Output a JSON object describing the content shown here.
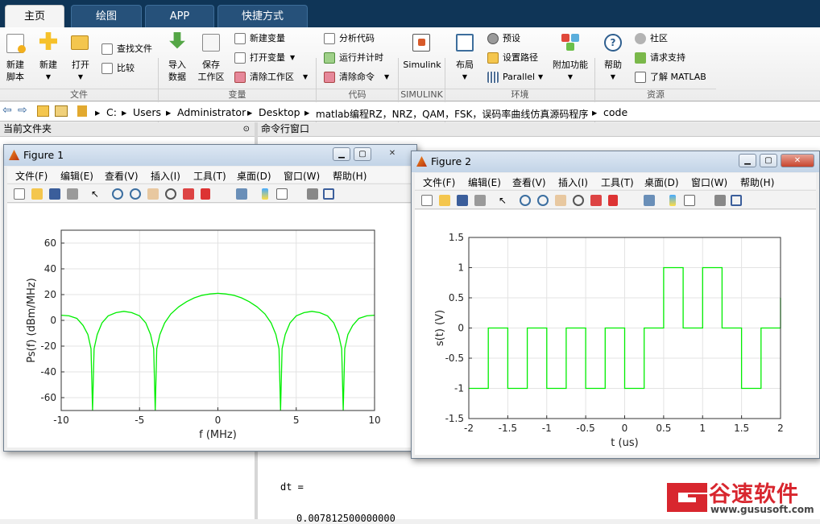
{
  "tabs": {
    "home": "主页",
    "plots": "绘图",
    "apps": "APP",
    "shortcuts": "快捷方式"
  },
  "ribbon": {
    "new_script": [
      "新建",
      "脚本"
    ],
    "new": "新建",
    "open": "打开",
    "find_files": "查找文件",
    "compare": "比较",
    "import": [
      "导入",
      "数据"
    ],
    "save_ws": [
      "保存",
      "工作区"
    ],
    "new_var": "新建变量",
    "open_var": "打开变量",
    "clear_ws": "清除工作区",
    "analyze": "分析代码",
    "run_time": "运行并计时",
    "clear_cmd": "清除命令",
    "simulink": "Simulink",
    "layout": "布局",
    "prefs": "预设",
    "set_path": "设置路径",
    "parallel": "Parallel",
    "addons": "附加功能",
    "help": "帮助",
    "community": "社区",
    "support": "请求支持",
    "learn": "了解 MATLAB",
    "sections": {
      "file": "文件",
      "variable": "变量",
      "code": "代码",
      "simulink": "SIMULINK",
      "env": "环境",
      "resources": "资源"
    }
  },
  "address": {
    "parts": [
      "C:",
      "Users",
      "Administrator",
      "Desktop",
      "matlab编程RZ，NRZ，QAM，FSK，误码率曲线仿真源码程序",
      "code"
    ]
  },
  "panels": {
    "current_folder": "当前文件夹",
    "command_window": "命令行窗口"
  },
  "command": {
    "line1": "dt =",
    "line2": "0.007812500000000"
  },
  "figure_menu": [
    "文件(F)",
    "编辑(E)",
    "查看(V)",
    "插入(I)",
    "工具(T)",
    "桌面(D)",
    "窗口(W)",
    "帮助(H)"
  ],
  "figure1": {
    "title": "Figure 1",
    "chart_data": {
      "type": "line",
      "xlabel": "f  (MHz)",
      "ylabel": "Ps(f)  (dBm/MHz)",
      "xlim": [
        -10,
        10
      ],
      "ylim": [
        -70,
        70
      ],
      "xticks": [
        "-10",
        "-5",
        "0",
        "5",
        "10"
      ],
      "yticks": [
        "60",
        "40",
        "20",
        "0",
        "-20",
        "-40",
        "-60"
      ],
      "grid": true,
      "color": "#00ee00",
      "x": [
        -10,
        -9.5,
        -9,
        -8.6,
        -8.3,
        -8.1,
        -8,
        -7.9,
        -7.7,
        -7.4,
        -7,
        -6.5,
        -6,
        -5.5,
        -5,
        -4.6,
        -4.3,
        -4.1,
        -4,
        -3.9,
        -3.7,
        -3.4,
        -3,
        -2.5,
        -2,
        -1.5,
        -1,
        -0.5,
        0,
        0.5,
        1,
        1.5,
        2,
        2.5,
        3,
        3.4,
        3.7,
        3.9,
        4,
        4.1,
        4.3,
        4.6,
        5,
        5.5,
        6,
        6.5,
        7,
        7.4,
        7.7,
        7.9,
        8,
        8.1,
        8.3,
        8.6,
        9,
        9.5,
        10
      ],
      "y": [
        4,
        3.5,
        1.5,
        -4,
        -11,
        -22,
        -70,
        -22,
        -11,
        -2,
        3.5,
        6,
        7,
        6,
        3.5,
        -2,
        -11,
        -22,
        -70,
        -22,
        -11,
        -2,
        5,
        10.5,
        14.5,
        17.5,
        19.5,
        20.5,
        21,
        20.5,
        19.5,
        17.5,
        14.5,
        10.5,
        5,
        -2,
        -11,
        -22,
        -70,
        -22,
        -11,
        -2,
        3.5,
        6,
        7,
        6,
        3.5,
        -2,
        -11,
        -22,
        -70,
        -22,
        -11,
        -4,
        1.5,
        3.5,
        4
      ]
    }
  },
  "figure2": {
    "title": "Figure 2",
    "chart_data": {
      "type": "line",
      "xlabel": "t (us)",
      "ylabel": "s(t) (V)",
      "xlim": [
        -2,
        2
      ],
      "ylim": [
        -1.5,
        1.5
      ],
      "xticks": [
        "-2",
        "-1.5",
        "-1",
        "-0.5",
        "0",
        "0.5",
        "1",
        "1.5",
        "2"
      ],
      "yticks": [
        "1.5",
        "1",
        "0.5",
        "0",
        "-0.5",
        "-1",
        "-1.5"
      ],
      "grid": true,
      "color": "#00ee00",
      "x": [
        -2,
        -1.75,
        -1.75,
        -1.5,
        -1.5,
        -1.25,
        -1.25,
        -1,
        -1,
        -0.75,
        -0.75,
        -0.5,
        -0.5,
        -0.25,
        -0.25,
        0,
        0,
        0.25,
        0.25,
        0.5,
        0.5,
        0.75,
        0.75,
        1,
        1,
        1.25,
        1.25,
        1.5,
        1.5,
        1.75,
        1.75,
        2,
        2
      ],
      "y": [
        -1,
        -1,
        0,
        0,
        -1,
        -1,
        0,
        0,
        -1,
        -1,
        0,
        0,
        -1,
        -1,
        0,
        0,
        -1,
        -1,
        0,
        0,
        1,
        1,
        0,
        0,
        1,
        1,
        0,
        0,
        -1,
        -1,
        0,
        0,
        0.5
      ]
    }
  },
  "watermark": {
    "brand": "谷速软件",
    "url": "www.gususoft.com"
  },
  "colors": {
    "tabbar": "#0f3557",
    "accent": "#d8262e"
  }
}
